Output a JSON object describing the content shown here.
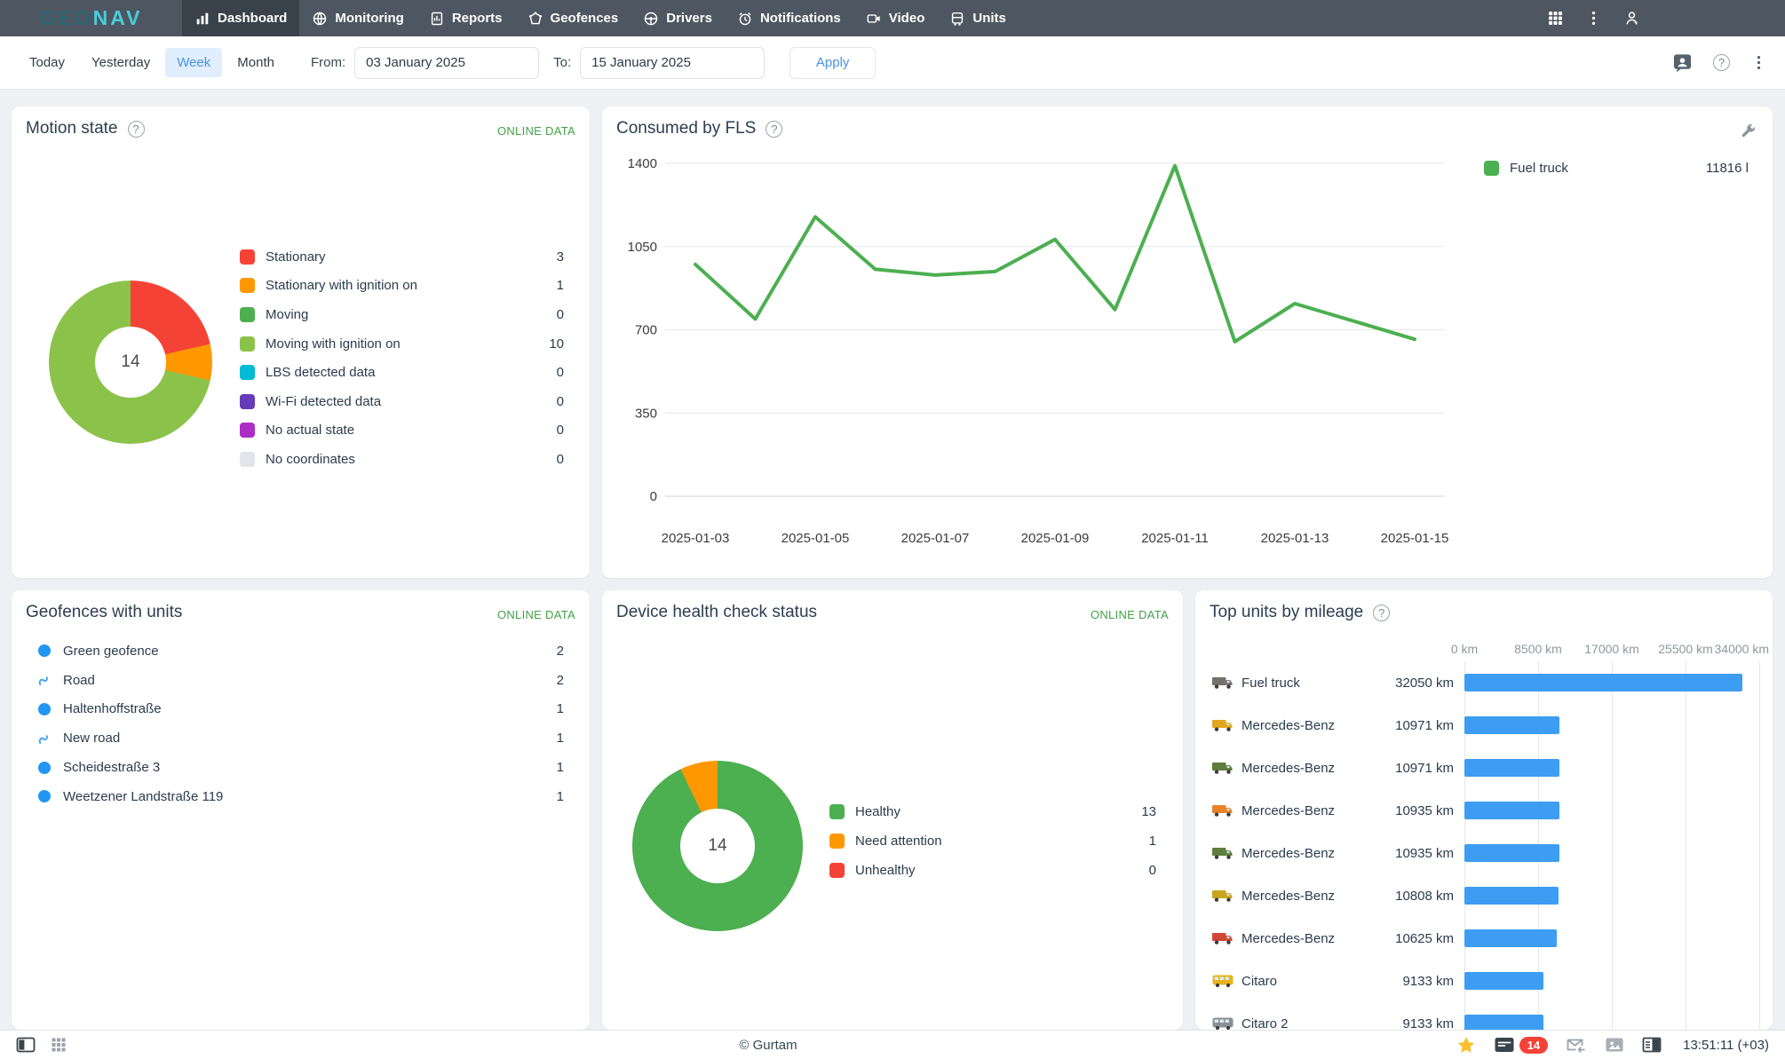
{
  "brand": {
    "geo": "GEO",
    "nav": "NAV"
  },
  "nav": {
    "items": [
      {
        "label": "Dashboard",
        "icon": "dashboard-icon",
        "active": true
      },
      {
        "label": "Monitoring",
        "icon": "monitoring-icon",
        "active": false
      },
      {
        "label": "Reports",
        "icon": "reports-icon",
        "active": false
      },
      {
        "label": "Geofences",
        "icon": "geofences-icon",
        "active": false
      },
      {
        "label": "Drivers",
        "icon": "drivers-icon",
        "active": false
      },
      {
        "label": "Notifications",
        "icon": "notifications-icon",
        "active": false
      },
      {
        "label": "Video",
        "icon": "video-icon",
        "active": false
      },
      {
        "label": "Units",
        "icon": "units-icon",
        "active": false
      }
    ]
  },
  "filterbar": {
    "presets": [
      "Today",
      "Yesterday",
      "Week",
      "Month"
    ],
    "selected_preset": "Week",
    "from_label": "From:",
    "from_value": "03 January 2025",
    "to_label": "To:",
    "to_value": "15 January 2025",
    "apply_label": "Apply"
  },
  "panels": {
    "motion_state": {
      "title": "Motion state",
      "online_data": "ONLINE DATA"
    },
    "consumed_by_fls": {
      "title": "Consumed by FLS"
    },
    "geofences": {
      "title": "Geofences with units",
      "online_data": "ONLINE DATA",
      "rows": [
        {
          "name": "Green geofence",
          "value": "2",
          "icon": "geofence-circle-icon"
        },
        {
          "name": "Road",
          "value": "2",
          "icon": "route-icon"
        },
        {
          "name": "Haltenhoffstraße",
          "value": "1",
          "icon": "geofence-circle-icon"
        },
        {
          "name": "New road",
          "value": "1",
          "icon": "route-icon"
        },
        {
          "name": "Scheidestraße 3",
          "value": "1",
          "icon": "geofence-circle-icon"
        },
        {
          "name": "Weetzener Landstraße 119",
          "value": "1",
          "icon": "geofence-circle-icon"
        }
      ]
    },
    "device_health": {
      "title": "Device health check status",
      "online_data": "ONLINE DATA"
    },
    "top_mileage": {
      "title": "Top units by mileage",
      "trucks": [
        {
          "vehicle": "truck",
          "color": "#75716b"
        },
        {
          "vehicle": "truck",
          "color": "#e0a81f"
        },
        {
          "vehicle": "truck",
          "color": "#5f7d3b"
        },
        {
          "vehicle": "truck",
          "color": "#e8822a"
        },
        {
          "vehicle": "truck",
          "color": "#5f7d3b"
        },
        {
          "vehicle": "truck",
          "color": "#caa61d"
        },
        {
          "vehicle": "truck",
          "color": "#d14836"
        },
        {
          "vehicle": "bus",
          "color": "#e8b420"
        },
        {
          "vehicle": "bus",
          "color": "#8a8f96"
        }
      ]
    }
  },
  "chart_data": [
    {
      "id": "motion_state",
      "type": "pie",
      "title": "Motion state",
      "labels": [
        "Stationary",
        "Stationary with ignition on",
        "Moving",
        "Moving with ignition on",
        "LBS detected data",
        "Wi-Fi detected data",
        "No actual state",
        "No coordinates"
      ],
      "values": [
        3,
        1,
        0,
        10,
        0,
        0,
        0,
        0
      ],
      "colors": [
        "#f44336",
        "#ff9800",
        "#4caf50",
        "#8bc34a",
        "#00bcd4",
        "#673ab7",
        "#ab2fc6",
        "#e2e4e9"
      ],
      "center_label": "14",
      "legend_position": "right"
    },
    {
      "id": "consumed_by_fls",
      "type": "line",
      "title": "Consumed by FLS",
      "x": [
        "2025-01-03",
        "2025-01-04",
        "2025-01-05",
        "2025-01-06",
        "2025-01-07",
        "2025-01-08",
        "2025-01-09",
        "2025-01-10",
        "2025-01-11",
        "2025-01-12",
        "2025-01-13",
        "2025-01-14",
        "2025-01-15"
      ],
      "series": [
        {
          "name": "Fuel truck",
          "values": [
            975,
            745,
            1175,
            955,
            930,
            945,
            1080,
            785,
            1390,
            650,
            810,
            735,
            660
          ],
          "color": "#4caf50",
          "total_label": "11816 l"
        }
      ],
      "ylim": [
        0,
        1400
      ],
      "yticks": [
        0,
        350,
        700,
        1050,
        1400
      ],
      "xtick_labels": [
        "2025-01-03",
        "2025-01-05",
        "2025-01-07",
        "2025-01-09",
        "2025-01-11",
        "2025-01-13",
        "2025-01-15"
      ],
      "grid": true,
      "legend_position": "top-right"
    },
    {
      "id": "device_health",
      "type": "pie",
      "title": "Device health check status",
      "labels": [
        "Healthy",
        "Need attention",
        "Unhealthy"
      ],
      "values": [
        13,
        1,
        0
      ],
      "colors": [
        "#4caf50",
        "#ff9800",
        "#f44336"
      ],
      "center_label": "14",
      "legend_position": "right"
    },
    {
      "id": "top_mileage",
      "type": "bar",
      "orientation": "horizontal",
      "title": "Top units by mileage",
      "categories": [
        "Fuel truck",
        "Mercedes-Benz",
        "Mercedes-Benz",
        "Mercedes-Benz",
        "Mercedes-Benz",
        "Mercedes-Benz",
        "Mercedes-Benz",
        "Citaro",
        "Citaro 2"
      ],
      "values": [
        32050,
        10971,
        10971,
        10935,
        10935,
        10808,
        10625,
        9133,
        9133
      ],
      "value_labels": [
        "32050 km",
        "10971 km",
        "10971 km",
        "10935 km",
        "10935 km",
        "10808 km",
        "10625 km",
        "9133 km",
        "9133 km"
      ],
      "xlim": [
        0,
        34000
      ],
      "xticks": [
        0,
        8500,
        17000,
        25500,
        34000
      ],
      "xtick_labels": [
        "0 km",
        "8500 km",
        "17000 km",
        "25500 km",
        "34000 km"
      ],
      "bar_color": "#3d9df3"
    }
  ],
  "statusbar": {
    "copyright": "© Gurtam",
    "badge_count": "14",
    "time": "13:51:11 (+03)"
  },
  "colors": {
    "accent_blue": "#3d9df3",
    "online_green": "#43a047",
    "nav_bg": "#4e5761",
    "nav_active_bg": "#39424b",
    "badge_red": "#f44336",
    "line_green": "#4caf50"
  }
}
